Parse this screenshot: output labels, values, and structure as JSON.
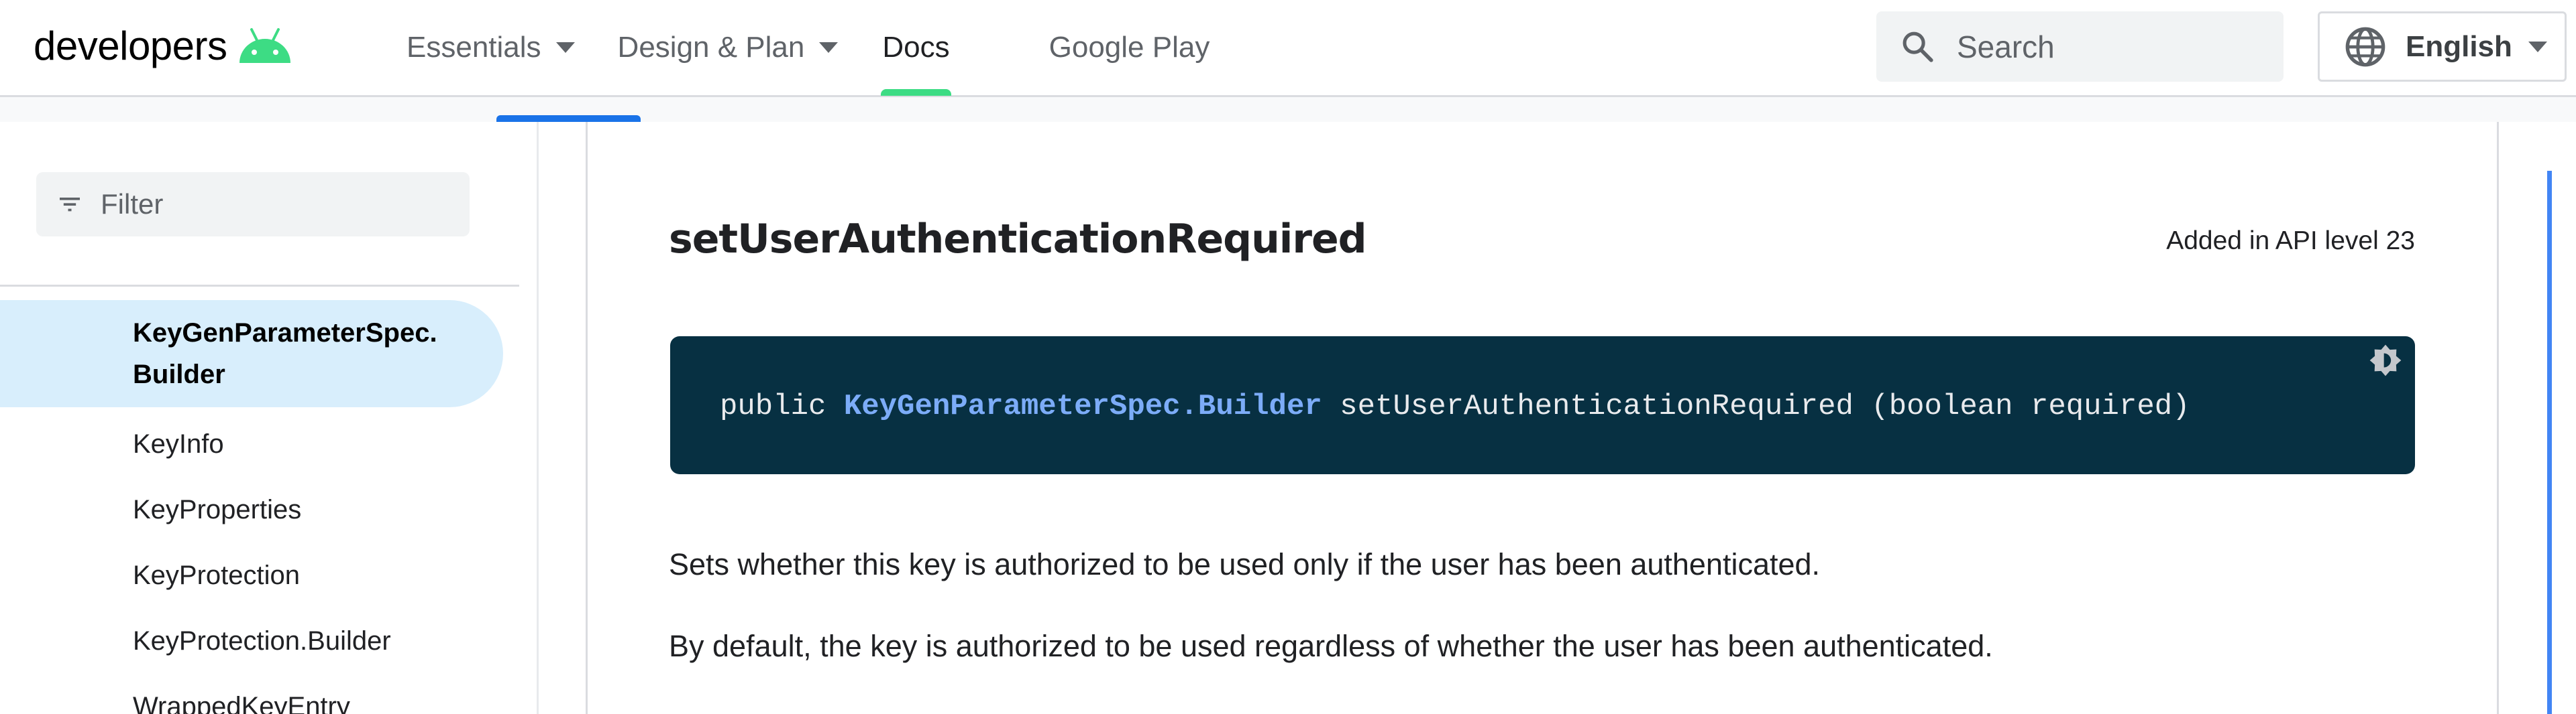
{
  "header": {
    "logo_text": "developers",
    "logo_icon": "android-icon",
    "nav": [
      {
        "label": "Essentials",
        "has_dropdown": true,
        "active": false
      },
      {
        "label": "Design & Plan",
        "has_dropdown": true,
        "active": false
      },
      {
        "label": "Docs",
        "has_dropdown": false,
        "active": true
      },
      {
        "label": "Google Play",
        "has_dropdown": false,
        "active": false
      }
    ],
    "search": {
      "placeholder": "Search",
      "icon": "search-icon"
    },
    "language": {
      "label": "English",
      "icon": "globe-icon"
    }
  },
  "sidebar": {
    "filter": {
      "placeholder": "Filter",
      "icon": "filter-icon"
    },
    "items": [
      {
        "label": "KeyGenParameterSpec.",
        "label_line2": "Builder",
        "active": true
      },
      {
        "label": "KeyInfo",
        "active": false
      },
      {
        "label": "KeyProperties",
        "active": false
      },
      {
        "label": "KeyProtection",
        "active": false
      },
      {
        "label": "KeyProtection.Builder",
        "active": false
      },
      {
        "label": "WrappedKeyEntry",
        "active": false
      }
    ]
  },
  "main": {
    "method_title": "setUserAuthenticationRequired",
    "api_level": "Added in API level 23",
    "code": {
      "modifier": "public ",
      "return_type": "KeyGenParameterSpec.Builder",
      "signature": " setUserAuthenticationRequired (boolean required)",
      "theme_toggle_icon": "brightness-toggle-icon"
    },
    "paragraphs": [
      "Sets whether this key is authorized to be used only if the user has been authenticated.",
      "By default, the key is authorized to be used regardless of whether the user has been authenticated."
    ]
  },
  "colors": {
    "android_green": "#3ddc84",
    "tab_blue": "#1a73e8",
    "code_background": "#073042",
    "code_link": "#7cacf8",
    "active_item_background": "#d8eefc"
  }
}
